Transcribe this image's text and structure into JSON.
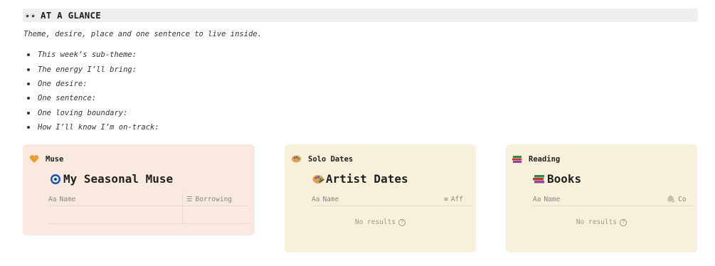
{
  "section": {
    "heading": "AT A GLANCE",
    "subtitle": "Theme, desire, place and one sentence to live inside."
  },
  "prompts": [
    "This week’s sub-theme:",
    "The energy I’ll bring:",
    "One desire:",
    "One sentence:",
    "One loving boundary:",
    "How I’ll know I’m on-track:"
  ],
  "cards": {
    "muse": {
      "label": "Muse",
      "db_title": "My Seasonal Muse",
      "columns": [
        "Name",
        "Borrowing"
      ]
    },
    "solo": {
      "label": "Solo Dates",
      "db_title": "Artist Dates",
      "columns": [
        "Name",
        "Aff"
      ],
      "empty_text": "No results"
    },
    "reading": {
      "label": "Reading",
      "db_title": "Books",
      "columns": [
        "Name",
        "Co"
      ],
      "empty_text": "No results"
    }
  },
  "colors": {
    "muse_bg": "#f9e9df",
    "solo_bg": "#f7f1dc",
    "heading_bg": "#efefee"
  },
  "icons": {
    "heading": "eyes-icon",
    "muse": "orange-heart-icon",
    "muse_db": "nazar-amulet-icon",
    "solo": "paint-palette-icon",
    "solo_db": "paint-palette-icon",
    "reading": "books-icon",
    "reading_db": "books-icon",
    "name_prop": "text-prop-icon",
    "list_prop": "list-prop-icon",
    "link_prop": "paperclip-icon"
  }
}
